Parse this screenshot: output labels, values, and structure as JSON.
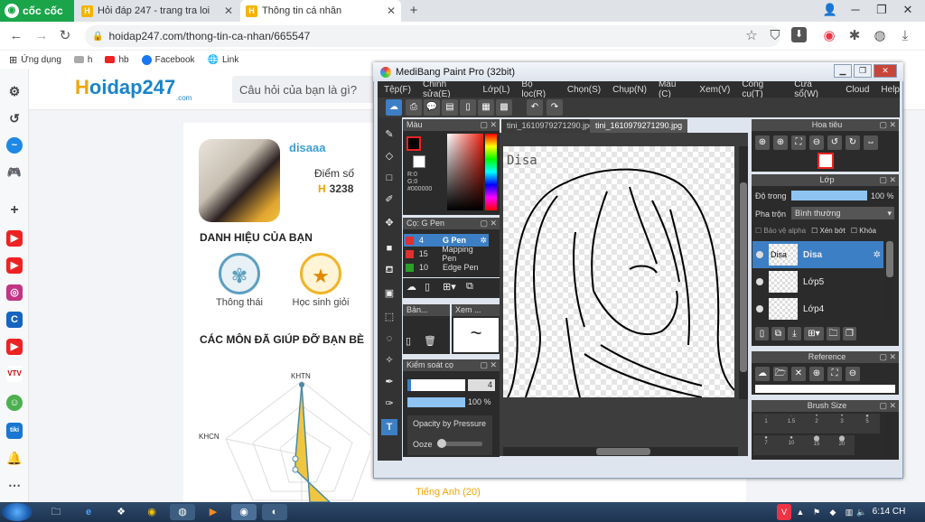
{
  "browser": {
    "brand": "cốc cốc",
    "tabs": [
      {
        "title": "Hỏi đáp 247 - trang tra loi"
      },
      {
        "title": "Thông tin cá nhân"
      }
    ],
    "url": "hoidap247.com/thong-tin-ca-nhan/665547",
    "bookmarks": [
      "Ứng dụng",
      "h",
      "hb",
      "Facebook",
      "Link"
    ]
  },
  "site": {
    "logo_h": "H",
    "logo_rest": "oidap247",
    "logo_sub": ".com",
    "search_placeholder": "Câu hỏi của bạn là gì?"
  },
  "profile": {
    "username": "disaaa",
    "points_label": "Điểm số",
    "points": "3238",
    "titles_heading": "DANH HIỆU CỦA BẠN",
    "badges": [
      {
        "label": "Thông thái",
        "icon": "wheat-icon",
        "color": "#5c9fc0"
      },
      {
        "label": "Học sinh giỏi",
        "icon": "star-medal-icon",
        "color": "#f0b429"
      }
    ],
    "subjects_heading": "CÁC MÔN ĐÃ GIÚP ĐỠ BẠN BÈ",
    "radar_labels": [
      "KHTN",
      "KHCN"
    ],
    "english_label": "Tiếng Anh (20)"
  },
  "medibang": {
    "title": "MediBang Paint Pro (32bit)",
    "menu": [
      "Tệp(F)",
      "Chỉnh sửa(E)",
      "Lớp(L)",
      "Bộ lọc(R)",
      "Chọn(S)",
      "Chụp(N)",
      "Màu (C)",
      "Xem(V)",
      "Công cụ(T)",
      "Cửa sổ(W)",
      "Cloud",
      "Help"
    ],
    "color_panel": {
      "title": "Màu",
      "r": "R:0",
      "g": "G:0",
      "hex": "#000000"
    },
    "brush_panel": {
      "title": "Cọ: G Pen",
      "items": [
        {
          "size": "4",
          "name": "G Pen",
          "color": "#e03030"
        },
        {
          "size": "15",
          "name": "Mapping Pen",
          "color": "#e03030"
        },
        {
          "size": "10",
          "name": "Edge Pen",
          "color": "#2aa02a"
        }
      ]
    },
    "ban_panel": {
      "title": "Bản...",
      "view_title": "Xem ..."
    },
    "brush_control": {
      "title": "Kiểm soát cọ",
      "size": "4",
      "opacity": "100 %",
      "opacity_value": 100,
      "pressure": "Opacity by Pressure",
      "ooze": "Ooze"
    },
    "canvas_tabs": [
      "tini_1610979271290.jpg",
      "tini_1610979271290.jpg"
    ],
    "canvas_text": "Disa",
    "navigator": {
      "title": "Hoa tiêu"
    },
    "layer_panel": {
      "title": "Lớp",
      "opacity_label": "Độ trong",
      "opacity": "100 %",
      "opacity_value": 100,
      "blend_label": "Pha trộn",
      "blend_mode": "Bình thường",
      "protect_alpha": "Bảo vệ alpha",
      "clipping": "Xén bớt",
      "lock": "Khóa",
      "layers": [
        {
          "name": "Disa",
          "thumb": "Disa"
        },
        {
          "name": "Lớp5",
          "thumb": ""
        },
        {
          "name": "Lớp4",
          "thumb": ""
        }
      ]
    },
    "reference": {
      "title": "Reference"
    },
    "brush_size": {
      "title": "Brush Size",
      "values": [
        "1",
        "1.5",
        "2",
        "3",
        "5",
        "7",
        "10",
        "15",
        "20"
      ]
    }
  },
  "taskbar": {
    "time": "6:14 CH",
    "date": "19/01/2021"
  }
}
